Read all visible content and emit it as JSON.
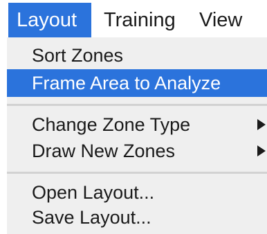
{
  "menubar": {
    "items": [
      {
        "label": "Layout",
        "active": true
      },
      {
        "label": "Training",
        "active": false
      },
      {
        "label": "View",
        "active": false
      }
    ]
  },
  "dropdown": {
    "groups": [
      [
        {
          "label": "Sort Zones",
          "highlighted": false,
          "submenu": false
        },
        {
          "label": "Frame Area to Analyze",
          "highlighted": true,
          "submenu": false
        }
      ],
      [
        {
          "label": "Change Zone Type",
          "highlighted": false,
          "submenu": true
        },
        {
          "label": "Draw New Zones",
          "highlighted": false,
          "submenu": true
        }
      ],
      [
        {
          "label": "Open Layout...",
          "highlighted": false,
          "submenu": false
        },
        {
          "label": "Save Layout...",
          "highlighted": false,
          "submenu": false
        }
      ]
    ]
  },
  "colors": {
    "highlight": "#2b73dc",
    "menu_bg": "#efefef",
    "separator": "#d2d2d2",
    "text": "#1a1a1a"
  },
  "icons": {
    "submenu": "submenu-arrow-icon"
  }
}
